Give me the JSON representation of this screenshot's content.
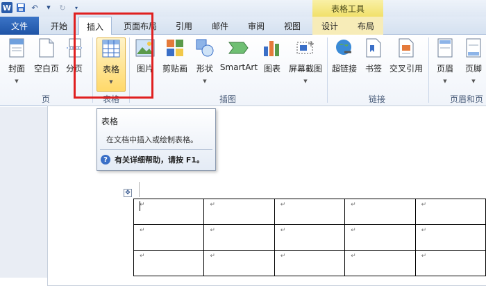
{
  "app": {
    "logo": "W",
    "context_tab_title": "表格工具"
  },
  "tabs": {
    "file": "文件",
    "items": [
      "开始",
      "插入",
      "页面布局",
      "引用",
      "邮件",
      "审阅",
      "视图",
      "设计",
      "布局"
    ],
    "active": "插入"
  },
  "ribbon": {
    "groups": {
      "pages": "页",
      "illustrations": "插图",
      "links": "链接",
      "header_footer": "页眉和页"
    },
    "buttons": {
      "cover": "封面",
      "blank_page": "空白页",
      "page_break": "分页",
      "table": "表格",
      "picture": "图片",
      "clipart": "剪贴画",
      "shapes": "形状",
      "smartart": "SmartArt",
      "chart": "图表",
      "screenshot": "屏幕截图",
      "hyperlink": "超链接",
      "bookmark": "书签",
      "cross_reference": "交叉引用",
      "header": "页眉",
      "footer": "页脚"
    }
  },
  "tooltip": {
    "title": "表格",
    "description": "在文档中插入或绘制表格。",
    "help": "有关详细帮助，请按 F1。"
  },
  "document": {
    "cell_mark": "↵"
  },
  "colors": {
    "highlight": "#e02020",
    "file_tab": "#2a5caa",
    "context_tab": "#f1e06a"
  }
}
